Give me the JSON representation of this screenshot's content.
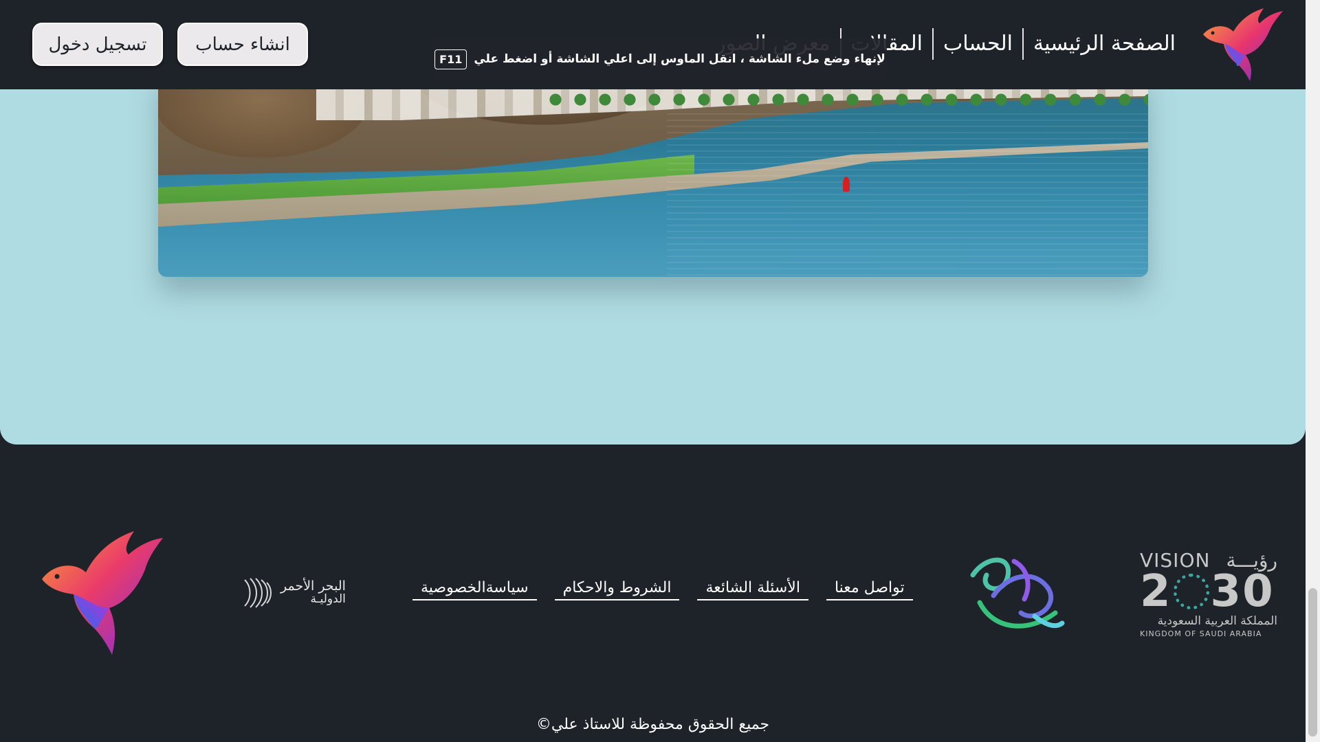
{
  "nav": {
    "links": [
      {
        "label": "الصفحة الرئيسية"
      },
      {
        "label": "الحساب"
      },
      {
        "label": "المقالات"
      },
      {
        "label": "معرض الصور"
      }
    ],
    "signup_label": "انشاء حساب",
    "login_label": "تسجيل دخول",
    "logo_icon": "colorful-bird-logo"
  },
  "fullscreen_notice": {
    "text": "لإنهاء وضع ملء الشاشة ، انقل الماوس إلى اعلي الشاشة أو اضغط علي",
    "key": "F11"
  },
  "hero": {
    "image_icon": "coastal-city-photo"
  },
  "footer": {
    "links": [
      {
        "label": "تواصل معنا"
      },
      {
        "label": "الأسئلة الشائعة"
      },
      {
        "label": "الشروط والاحكام"
      },
      {
        "label": "سياسةالخصوصية"
      }
    ],
    "redsea": {
      "line1": "البحر الأحمر",
      "line2": "الدوليـة"
    },
    "vision": {
      "word_en": "VISION",
      "word_ar": "رؤيـــة",
      "year_left": "2",
      "year_right": "30",
      "country_ar": "المملكة العربية السعودية",
      "country_en": "KINGDOM OF SAUDI ARABIA"
    },
    "copyright": "©جميع الحقوق محفوظة للاستاذ علي"
  },
  "colors": {
    "navbar_bg": "#1e2229",
    "section_bg": "#afdce2",
    "button_bg": "#ece9ec"
  }
}
